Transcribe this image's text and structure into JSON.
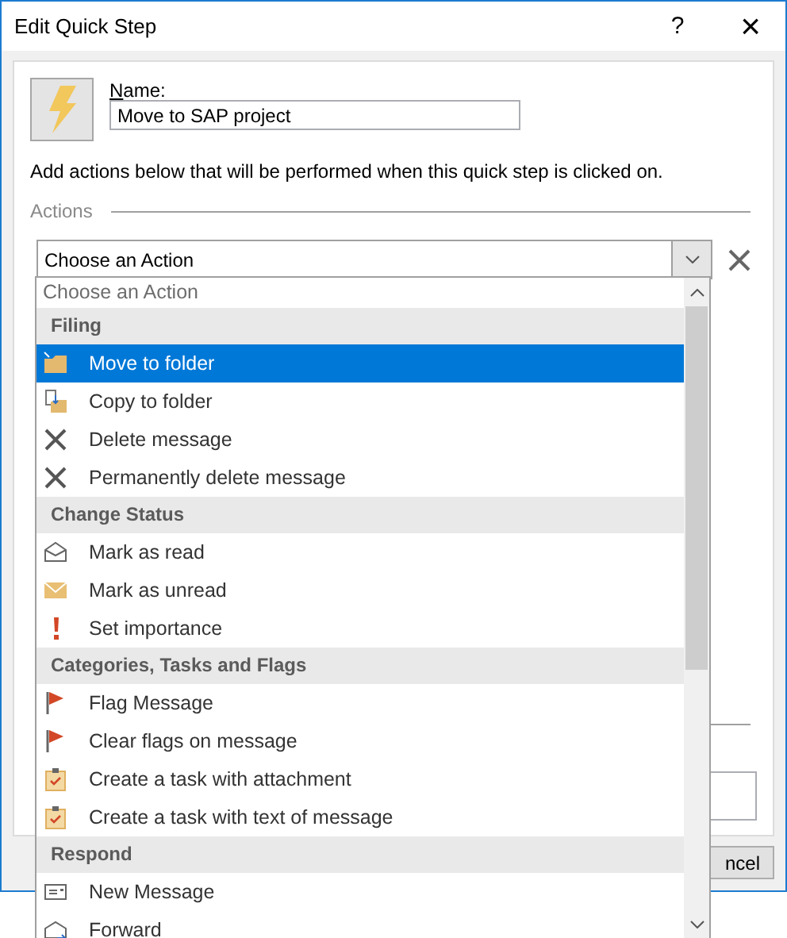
{
  "window": {
    "title": "Edit Quick Step",
    "help": "?",
    "close": "×"
  },
  "name": {
    "label": "Name:",
    "value": "Move to SAP project"
  },
  "description": "Add actions below that will be performed when this quick step is clicked on.",
  "actions_heading": "Actions",
  "combo": {
    "value": "Choose an Action"
  },
  "dropdown": {
    "placeholder": "Choose an Action",
    "items": [
      {
        "kind": "header",
        "label": "Filing"
      },
      {
        "kind": "move",
        "label": "Move to folder",
        "selected": true
      },
      {
        "kind": "copy",
        "label": "Copy to folder",
        "selected": false
      },
      {
        "kind": "delete",
        "label": "Delete message",
        "selected": false
      },
      {
        "kind": "delete",
        "label": "Permanently delete message",
        "selected": false
      },
      {
        "kind": "header",
        "label": "Change Status"
      },
      {
        "kind": "read",
        "label": "Mark as read",
        "selected": false
      },
      {
        "kind": "unread",
        "label": "Mark as unread",
        "selected": false
      },
      {
        "kind": "importance",
        "label": "Set importance",
        "selected": false
      },
      {
        "kind": "header",
        "label": "Categories, Tasks and Flags"
      },
      {
        "kind": "flag",
        "label": "Flag Message",
        "selected": false
      },
      {
        "kind": "flag",
        "label": "Clear flags on message",
        "selected": false
      },
      {
        "kind": "task",
        "label": "Create a task with attachment",
        "selected": false
      },
      {
        "kind": "task",
        "label": "Create a task with text of message",
        "selected": false
      },
      {
        "kind": "header",
        "label": "Respond"
      },
      {
        "kind": "new",
        "label": "New Message",
        "selected": false
      },
      {
        "kind": "forward",
        "label": "Forward",
        "selected": false
      }
    ]
  },
  "cancel_button": "ncel"
}
